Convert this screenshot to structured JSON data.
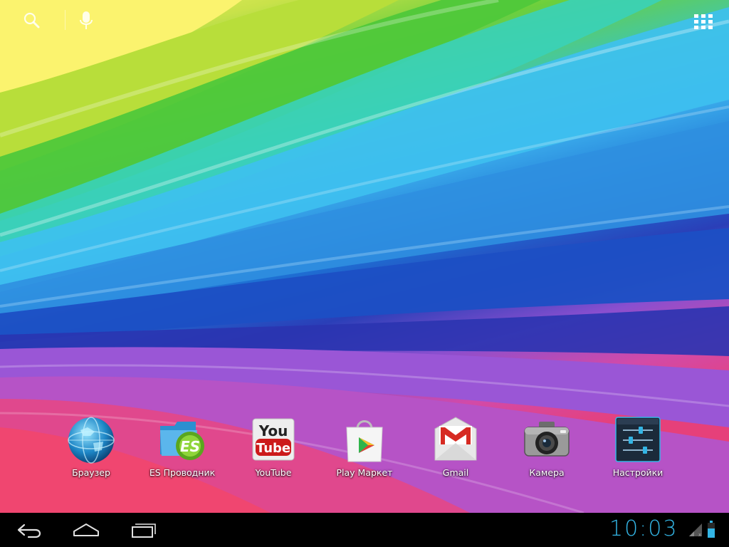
{
  "topbar": {
    "search_icon": "search-icon",
    "voice_icon": "microphone-icon",
    "apps_icon": "all-apps-grid-icon"
  },
  "dock": {
    "apps": [
      {
        "label": "Браузер",
        "icon": "browser-globe-icon"
      },
      {
        "label": "ES Проводник",
        "icon": "es-file-explorer-icon"
      },
      {
        "label": "YouTube",
        "icon": "youtube-icon"
      },
      {
        "label": "Play Маркет",
        "icon": "play-store-icon"
      },
      {
        "label": "Gmail",
        "icon": "gmail-icon"
      },
      {
        "label": "Камера",
        "icon": "camera-icon"
      },
      {
        "label": "Настройки",
        "icon": "settings-sliders-icon"
      }
    ],
    "youtube_logo_top": "You",
    "youtube_logo_bottom": "Tube",
    "es_logo_text": "ES"
  },
  "navbar": {
    "back_icon": "back-icon",
    "home_icon": "home-icon",
    "recent_icon": "recent-apps-icon"
  },
  "status": {
    "clock": "10:03",
    "signal_icon": "signal-icon",
    "battery_icon": "battery-icon"
  },
  "colors": {
    "accent": "#33b5e5",
    "navbar_bg": "#000000"
  }
}
